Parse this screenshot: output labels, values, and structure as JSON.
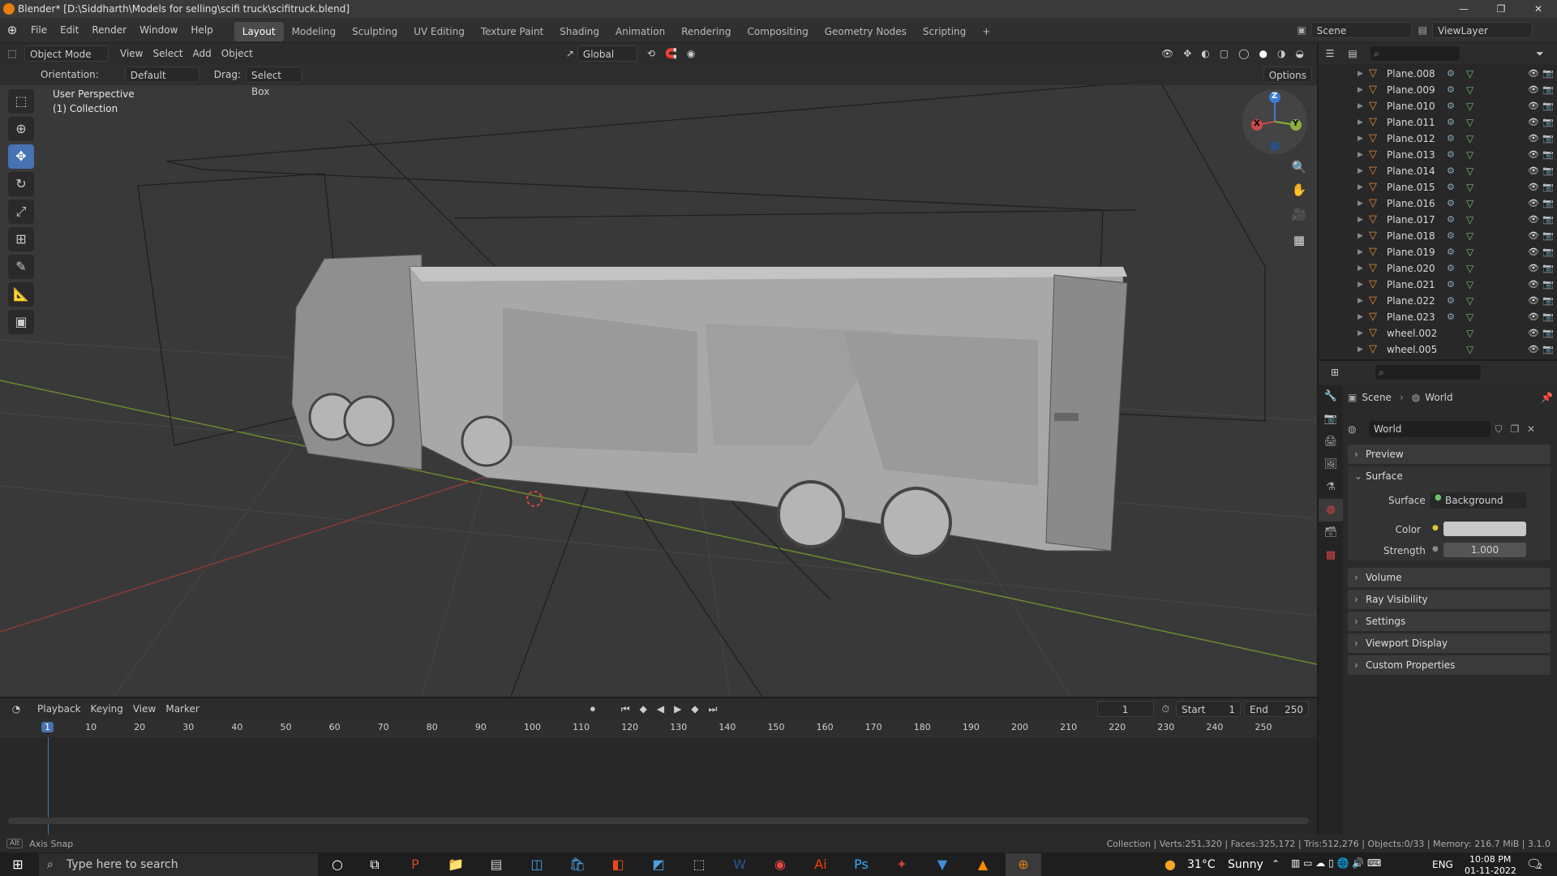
{
  "window": {
    "title": "Blender* [D:\\Siddharth\\Models for selling\\scifi truck\\scifitruck.blend]",
    "minimize": "—",
    "maximize": "❐",
    "close": "✕"
  },
  "menu": {
    "items": [
      "File",
      "Edit",
      "Render",
      "Window",
      "Help"
    ],
    "workspaces": [
      "Layout",
      "Modeling",
      "Sculpting",
      "UV Editing",
      "Texture Paint",
      "Shading",
      "Animation",
      "Rendering",
      "Compositing",
      "Geometry Nodes",
      "Scripting"
    ],
    "active_workspace": "Layout",
    "add_tab": "+",
    "scene_label": "Scene",
    "viewlayer_label": "ViewLayer"
  },
  "viewport_header": {
    "mode": "Object Mode",
    "menus": [
      "View",
      "Select",
      "Add",
      "Object"
    ],
    "transform": "Global",
    "options": "Options"
  },
  "tool_settings": {
    "orientation_label": "Orientation:",
    "orientation_value": "Default",
    "drag_label": "Drag:",
    "drag_value": "Select Box"
  },
  "viewport": {
    "perspective": "User Perspective",
    "collection": "(1) Collection",
    "gizmo_axes": [
      "Z",
      "Y",
      "X"
    ]
  },
  "outliner": {
    "items": [
      {
        "name": "Plane.008",
        "modifier": true
      },
      {
        "name": "Plane.009",
        "modifier": true
      },
      {
        "name": "Plane.010",
        "modifier": true
      },
      {
        "name": "Plane.011",
        "modifier": true
      },
      {
        "name": "Plane.012",
        "modifier": true
      },
      {
        "name": "Plane.013",
        "modifier": true
      },
      {
        "name": "Plane.014",
        "modifier": true
      },
      {
        "name": "Plane.015",
        "modifier": true
      },
      {
        "name": "Plane.016",
        "modifier": true
      },
      {
        "name": "Plane.017",
        "modifier": true
      },
      {
        "name": "Plane.018",
        "modifier": true
      },
      {
        "name": "Plane.019",
        "modifier": true
      },
      {
        "name": "Plane.020",
        "modifier": true
      },
      {
        "name": "Plane.021",
        "modifier": true
      },
      {
        "name": "Plane.022",
        "modifier": true
      },
      {
        "name": "Plane.023",
        "modifier": true
      },
      {
        "name": "wheel.002",
        "modifier": false
      },
      {
        "name": "wheel.005",
        "modifier": false
      }
    ]
  },
  "properties": {
    "breadcrumb_scene": "Scene",
    "breadcrumb_world": "World",
    "world_name": "World",
    "panels": {
      "preview": "Preview",
      "surface": "Surface",
      "volume": "Volume",
      "ray_visibility": "Ray Visibility",
      "settings": "Settings",
      "viewport_display": "Viewport Display",
      "custom_properties": "Custom Properties"
    },
    "surface_label": "Surface",
    "surface_value": "Background",
    "color_label": "Color",
    "strength_label": "Strength",
    "strength_value": "1.000",
    "color_swatch": "#c8c8c8"
  },
  "timeline": {
    "menus": [
      "Playback",
      "Keying",
      "View",
      "Marker"
    ],
    "current_frame": "1",
    "start_label": "Start",
    "start_value": "1",
    "end_label": "End",
    "end_value": "250",
    "ruler": [
      "1",
      "10",
      "20",
      "30",
      "40",
      "50",
      "60",
      "70",
      "80",
      "90",
      "100",
      "110",
      "120",
      "130",
      "140",
      "150",
      "160",
      "170",
      "180",
      "190",
      "200",
      "210",
      "220",
      "230",
      "240",
      "250"
    ]
  },
  "statusbar": {
    "left_key": "Alt",
    "left_text": "Axis Snap",
    "right_text": "Collection | Verts:251,320 | Faces:325,172 | Tris:512,276 | Objects:0/33 | Memory: 216.7 MiB | 3.1.0"
  },
  "taskbar": {
    "search_placeholder": "Type here to search",
    "weather_temp": "31°C",
    "weather_desc": "Sunny",
    "language": "ENG",
    "time": "10:08 PM",
    "date": "01-11-2022",
    "notification_count": "2"
  },
  "colors": {
    "accent": "#4772b3",
    "blender_orange": "#e87d0d",
    "x_axis": "#c94a4a",
    "y_axis": "#8bb03a",
    "z_axis": "#3c7bd9"
  }
}
